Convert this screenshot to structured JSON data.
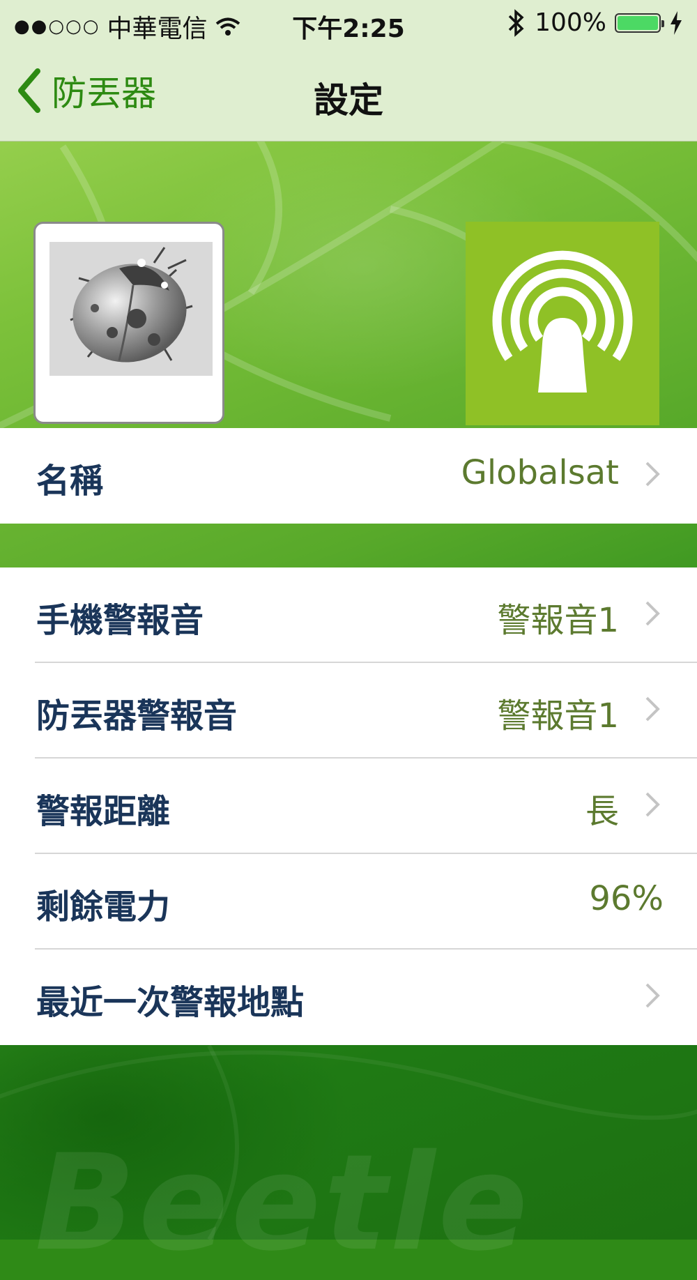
{
  "status_bar": {
    "signal_dots": "●●○○○",
    "carrier": "中華電信",
    "time": "下午2:25",
    "battery_percent": "100%",
    "icons": [
      "wifi-icon",
      "bluetooth-icon",
      "battery-icon",
      "charging-icon"
    ]
  },
  "nav": {
    "back_label": "防丟器",
    "title": "設定"
  },
  "header": {
    "device_image": "beetle-image",
    "action_tile_icon": "broadcast-signal-icon",
    "accent_color": "#8fc126"
  },
  "settings": {
    "group1": [
      {
        "label": "名稱",
        "value": "Globalsat",
        "chevron": true
      }
    ],
    "group2": [
      {
        "label": "手機警報音",
        "value": "警報音1",
        "chevron": true
      },
      {
        "label": "防丟器警報音",
        "value": "警報音1",
        "chevron": true
      },
      {
        "label": "警報距離",
        "value": "長",
        "chevron": true
      },
      {
        "label": "剩餘電力",
        "value": "96%",
        "chevron": false
      },
      {
        "label": "最近一次警報地點",
        "value": "",
        "chevron": true
      }
    ]
  },
  "watermark": "Beetle",
  "colors": {
    "nav_tint": "#2d8a12",
    "label": "#1a3559",
    "value": "#5c7a2f"
  }
}
